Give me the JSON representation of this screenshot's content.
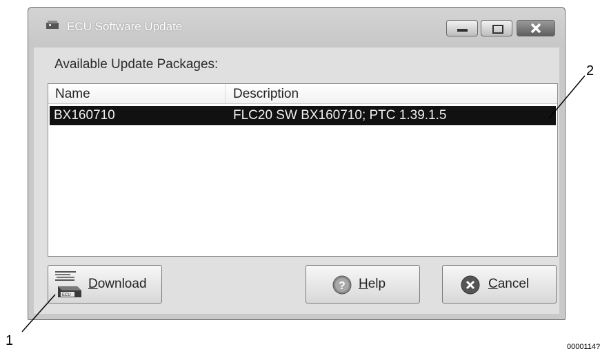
{
  "window": {
    "title": "ECU Software Update",
    "controls": [
      "minimize",
      "maximize",
      "close"
    ]
  },
  "panel": {
    "label": "Available Update Packages:"
  },
  "list": {
    "columns": [
      "Name",
      "Description"
    ],
    "rows": [
      {
        "name": "BX160710",
        "description": "FLC20 SW BX160710; PTC 1.39.1.5",
        "selected": true
      }
    ]
  },
  "buttons": {
    "download": {
      "mnemonic": "D",
      "rest": "ownload",
      "icon": "ecu-download-icon"
    },
    "help": {
      "mnemonic": "H",
      "rest": "elp",
      "icon": "help-icon"
    },
    "cancel": {
      "mnemonic": "C",
      "rest": "ancel",
      "icon": "cancel-icon"
    }
  },
  "callouts": [
    "1",
    "2"
  ],
  "figure_code": "0000114?"
}
